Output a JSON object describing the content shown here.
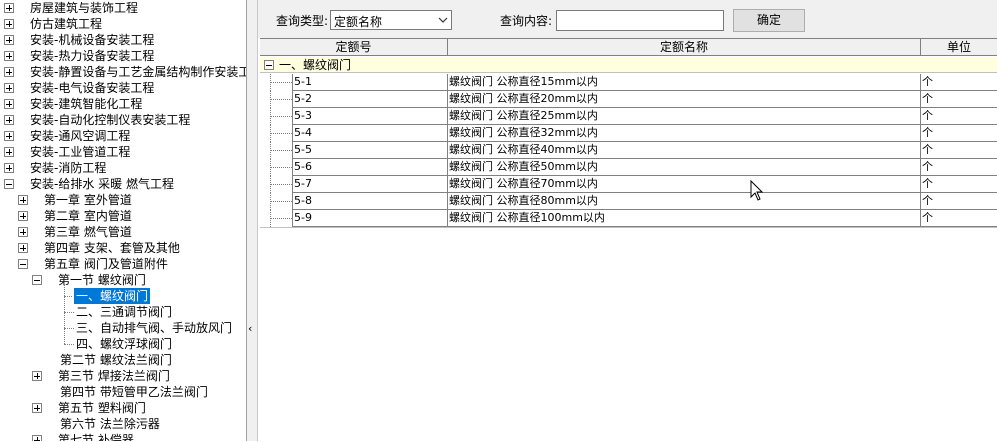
{
  "tree": {
    "items": [
      {
        "label": "房屋建筑与装饰工程",
        "level": 0,
        "expander": "plus"
      },
      {
        "label": "仿古建筑工程",
        "level": 0,
        "expander": "plus"
      },
      {
        "label": "安装-机械设备安装工程",
        "level": 0,
        "expander": "plus"
      },
      {
        "label": "安装-热力设备安装工程",
        "level": 0,
        "expander": "plus"
      },
      {
        "label": "安装-静置设备与工艺金属结构制作安装工",
        "level": 0,
        "expander": "plus"
      },
      {
        "label": "安装-电气设备安装工程",
        "level": 0,
        "expander": "plus"
      },
      {
        "label": "安装-建筑智能化工程",
        "level": 0,
        "expander": "plus"
      },
      {
        "label": "安装-自动化控制仪表安装工程",
        "level": 0,
        "expander": "plus"
      },
      {
        "label": "安装-通风空调工程",
        "level": 0,
        "expander": "plus"
      },
      {
        "label": "安装-工业管道工程",
        "level": 0,
        "expander": "plus"
      },
      {
        "label": "安装-消防工程",
        "level": 0,
        "expander": "plus"
      },
      {
        "label": "安装-给排水 采暖 燃气工程",
        "level": 0,
        "expander": "minus"
      },
      {
        "label": "第一章 室外管道",
        "level": 1,
        "expander": "plus"
      },
      {
        "label": "第二章 室内管道",
        "level": 1,
        "expander": "plus"
      },
      {
        "label": "第三章 燃气管道",
        "level": 1,
        "expander": "plus"
      },
      {
        "label": "第四章 支架、套管及其他",
        "level": 1,
        "expander": "plus"
      },
      {
        "label": "第五章 阀门及管道附件",
        "level": 1,
        "expander": "minus"
      },
      {
        "label": "第一节 螺纹阀门",
        "level": 2,
        "expander": "minus"
      },
      {
        "label": "一、螺纹阀门",
        "level": 3,
        "expander": "none",
        "selected": true
      },
      {
        "label": "二、三通调节阀门",
        "level": 3,
        "expander": "none"
      },
      {
        "label": "三、自动排气阀、手动放风门",
        "level": 3,
        "expander": "none"
      },
      {
        "label": "四、螺纹浮球阀门",
        "level": 3,
        "expander": "none"
      },
      {
        "label": "第二节 螺纹法兰阀门",
        "level": 2,
        "expander": "none"
      },
      {
        "label": "第三节 焊接法兰阀门",
        "level": 2,
        "expander": "plus"
      },
      {
        "label": "第四节 带短管甲乙法兰阀门",
        "level": 2,
        "expander": "none"
      },
      {
        "label": "第五节 塑料阀门",
        "level": 2,
        "expander": "plus"
      },
      {
        "label": "第六节 法兰除污器",
        "level": 2,
        "expander": "none"
      },
      {
        "label": "第七节 补偿器",
        "level": 2,
        "expander": "plus"
      }
    ]
  },
  "search": {
    "type_label": "查询类型:",
    "type_value": "定额名称",
    "content_label": "查询内容:",
    "content_value": "",
    "ok_label": "确定"
  },
  "grid": {
    "headers": [
      "定额号",
      "定额名称",
      "单位"
    ],
    "group_label": "一、螺纹阀门",
    "rows": [
      {
        "code": "5-1",
        "name": "螺纹阀门 公称直径15mm以内",
        "unit": "个"
      },
      {
        "code": "5-2",
        "name": "螺纹阀门 公称直径20mm以内",
        "unit": "个"
      },
      {
        "code": "5-3",
        "name": "螺纹阀门 公称直径25mm以内",
        "unit": "个"
      },
      {
        "code": "5-4",
        "name": "螺纹阀门 公称直径32mm以内",
        "unit": "个"
      },
      {
        "code": "5-5",
        "name": "螺纹阀门 公称直径40mm以内",
        "unit": "个"
      },
      {
        "code": "5-6",
        "name": "螺纹阀门 公称直径50mm以内",
        "unit": "个"
      },
      {
        "code": "5-7",
        "name": "螺纹阀门 公称直径70mm以内",
        "unit": "个"
      },
      {
        "code": "5-8",
        "name": "螺纹阀门 公称直径80mm以内",
        "unit": "个"
      },
      {
        "code": "5-9",
        "name": "螺纹阀门 公称直径100mm以内",
        "unit": "个"
      }
    ]
  },
  "colors": {
    "selection": "#0078d7",
    "group_bg": "#ffffe0",
    "toolbar_bg": "#f0f0f0"
  },
  "icons": {
    "expander": "plus-minus-box-icon",
    "collapse": "chevron-left-icon",
    "dropdown": "chevron-down-icon",
    "cursor": "mouse-pointer-icon"
  }
}
